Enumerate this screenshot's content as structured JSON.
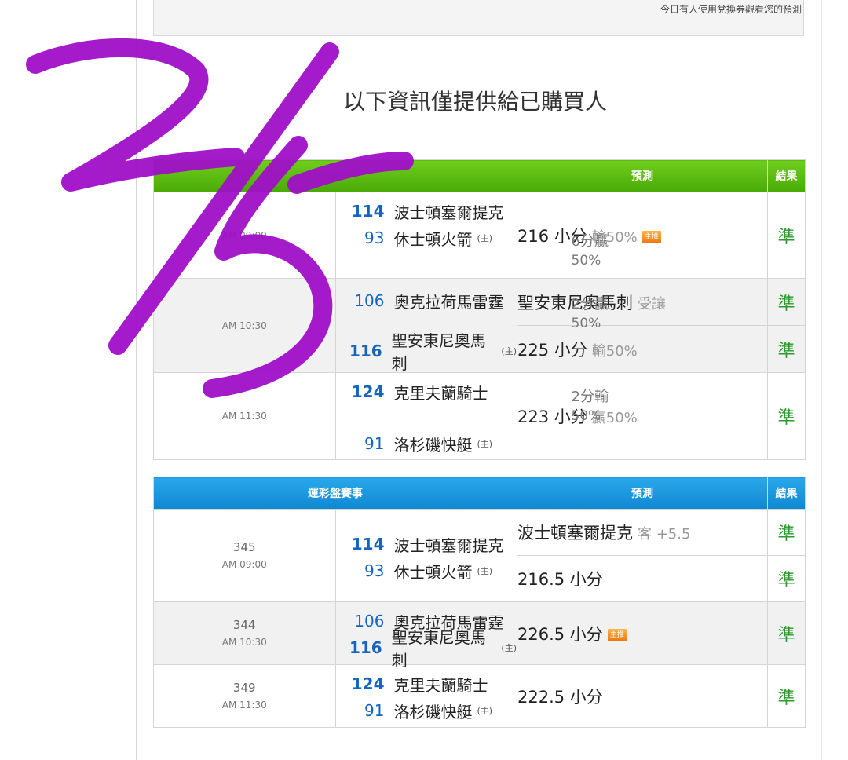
{
  "notice": "今日有人使用兌換券觀看您的預測",
  "buyer_title": "以下資訊僅提供給已購買人",
  "table1": {
    "headers": {
      "game": "",
      "prediction": "預測",
      "result": "結果"
    },
    "rows": [
      {
        "time": "AM 09:00",
        "away_score": "114",
        "away": "波士頓塞爾提克",
        "home_score": "93",
        "home": "休士頓火箭",
        "home_mark": "(主)",
        "spread": "6分贏",
        "spread_pct": "50%",
        "preds": [
          {
            "text": "216 小分",
            "muted": "輸50%",
            "badge": "主推",
            "result": "準"
          }
        ]
      },
      {
        "time": "AM 10:30",
        "away_score": "106",
        "away": "奧克拉荷馬雷霆",
        "home_score": "116",
        "home": "聖安東尼奧馬刺",
        "home_mark": "(主)",
        "spread": "2分贏",
        "spread_pct": "50%",
        "preds": [
          {
            "text": "聖安東尼奧馬刺",
            "muted": "受讓",
            "result": "準"
          },
          {
            "text": "225 小分",
            "muted": "輸50%",
            "result": "準"
          }
        ]
      },
      {
        "time": "AM 11:30",
        "away_score": "124",
        "away": "克里夫蘭騎士",
        "home_score": "91",
        "home": "洛杉磯快艇",
        "home_mark": "(主)",
        "spread": "2分輸",
        "spread_pct": "50%",
        "preds": [
          {
            "text": "223 小分",
            "muted": "贏50%",
            "result": "準"
          }
        ]
      }
    ]
  },
  "table2": {
    "headers": {
      "game": "運彩盤賽事",
      "prediction": "預測",
      "result": "結果"
    },
    "rows": [
      {
        "num": "345",
        "time": "AM 09:00",
        "away_score": "114",
        "away": "波士頓塞爾提克",
        "home_score": "93",
        "home": "休士頓火箭",
        "home_mark": "(主)",
        "preds": [
          {
            "text": "波士頓塞爾提克",
            "muted": "客 +5.5",
            "result": "準"
          },
          {
            "text": "216.5 小分",
            "result": "準"
          }
        ]
      },
      {
        "num": "344",
        "time": "AM 10:30",
        "away_score": "106",
        "away": "奧克拉荷馬雷霆",
        "home_score": "116",
        "home": "聖安東尼奧馬刺",
        "home_mark": "(主)",
        "preds": [
          {
            "text": "226.5 小分",
            "badge": "主推",
            "result": "準"
          }
        ]
      },
      {
        "num": "349",
        "time": "AM 11:30",
        "away_score": "124",
        "away": "克里夫蘭騎士",
        "home_score": "91",
        "home": "洛杉磯快艇",
        "home_mark": "(主)",
        "preds": [
          {
            "text": "222.5 小分",
            "result": "準"
          }
        ]
      }
    ]
  },
  "colors": {
    "green_header": "#4aaa06",
    "blue_header": "#0f87d2",
    "result_green": "#2a9a2a",
    "score_blue": "#1565c0",
    "scribble": "#a00fc8"
  }
}
